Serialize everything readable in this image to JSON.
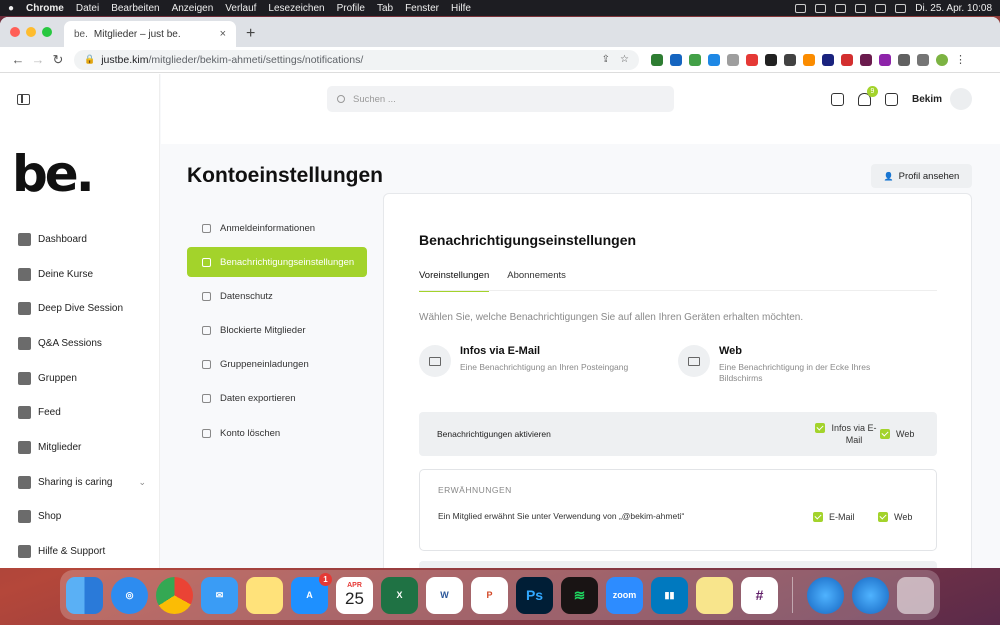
{
  "menubar": {
    "apple": "",
    "app": "Chrome",
    "items": [
      "Datei",
      "Bearbeiten",
      "Anzeigen",
      "Verlauf",
      "Lesezeichen",
      "Profile",
      "Tab",
      "Fenster",
      "Hilfe"
    ],
    "clock": "Di. 25. Apr.  10:08"
  },
  "browser": {
    "tab_title": "Mitglieder – just be.",
    "tab_favicon": "be.",
    "url_host": "justbe.kim",
    "url_path": "/mitglieder/bekim-ahmeti/settings/notifications/"
  },
  "sidebar": {
    "logo": "be.",
    "items": [
      {
        "label": "Dashboard",
        "icon": "home-icon"
      },
      {
        "label": "Deine Kurse",
        "icon": "courses-icon"
      },
      {
        "label": "Deep Dive Session",
        "icon": "star-icon"
      },
      {
        "label": "Q&A Sessions",
        "icon": "chat-icon"
      },
      {
        "label": "Gruppen",
        "icon": "groups-icon"
      },
      {
        "label": "Feed",
        "icon": "feed-icon"
      },
      {
        "label": "Mitglieder",
        "icon": "members-icon"
      },
      {
        "label": "Sharing is caring",
        "icon": "heart-icon"
      },
      {
        "label": "Shop",
        "icon": "cart-icon"
      },
      {
        "label": "Hilfe & Support",
        "icon": "help-icon"
      }
    ]
  },
  "header": {
    "search_placeholder": "Suchen ...",
    "notification_count": "9",
    "user_name": "Bekim"
  },
  "page": {
    "title": "Kontoeinstellungen",
    "profile_button": "Profil ansehen"
  },
  "settings_nav": [
    {
      "label": "Anmeldeinformationen",
      "active": false
    },
    {
      "label": "Benachrichtigungseinstellungen",
      "active": true
    },
    {
      "label": "Datenschutz",
      "active": false
    },
    {
      "label": "Blockierte Mitglieder",
      "active": false
    },
    {
      "label": "Gruppeneinladungen",
      "active": false
    },
    {
      "label": "Daten exportieren",
      "active": false
    },
    {
      "label": "Konto löschen",
      "active": false
    }
  ],
  "card": {
    "title": "Benachrichtigungseinstellungen",
    "tabs": [
      "Voreinstellungen",
      "Abonnements"
    ],
    "hint": "Wählen Sie, welche Benachrichtigungen Sie auf allen Ihren Geräten erhalten möchten.",
    "channels": [
      {
        "title": "Infos via E-Mail",
        "desc": "Eine Benachrichtigung an Ihren Posteingang"
      },
      {
        "title": "Web",
        "desc": "Eine Benachrichtigung in der Ecke Ihres Bildschirms"
      }
    ],
    "enable_row": {
      "label": "Benachrichtigungen aktivieren",
      "opt1": "Infos via E-Mail",
      "opt2": "Web"
    },
    "mentions": {
      "heading": "ERWÄHNUNGEN",
      "text": "Ein Mitglied erwähnt Sie unter Verwendung von „@bekim-ahmeti“",
      "opt1": "E-Mail",
      "opt2": "Web"
    }
  },
  "dock": {
    "calendar_month": "APR",
    "calendar_day": "25",
    "appstore_badge": "1",
    "apps": [
      "Finder",
      "Safari",
      "Chrome",
      "Mail",
      "Notes",
      "App Store",
      "Calendar",
      "Excel",
      "Word",
      "PowerPoint",
      "Photoshop",
      "Spotify",
      "Zoom",
      "Trello",
      "Stickies",
      "Slack",
      "Globe",
      "Globe",
      "Trash"
    ]
  },
  "colors": {
    "accent": "#a3d32b"
  }
}
